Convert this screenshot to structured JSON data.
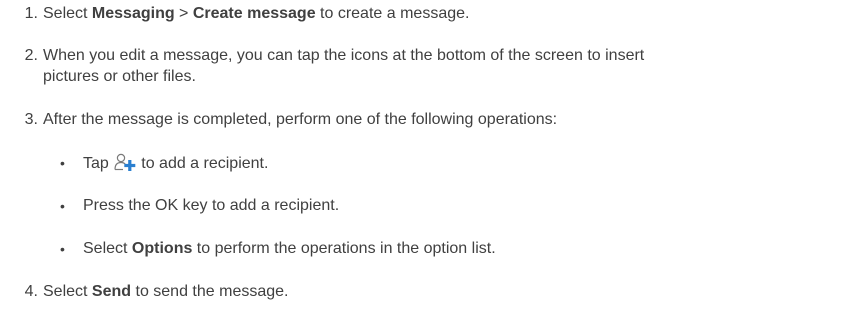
{
  "steps": [
    {
      "number": "1.",
      "pre": "Select ",
      "bold1": "Messaging",
      "mid": " > ",
      "bold2": "Create message",
      "post": " to create a message."
    },
    {
      "number": "2.",
      "line1": "When you edit a message, you can tap the icons at the bottom of the screen to insert",
      "line2": "pictures or other files."
    },
    {
      "number": "3.",
      "text": "After the message is completed, perform one of the following operations:"
    },
    {
      "number": "4.",
      "pre": "Select ",
      "bold": "Send",
      "post": " to send the message."
    }
  ],
  "bullets": [
    {
      "symbol": "•",
      "pre": "Tap ",
      "icon": "add-recipient-icon",
      "post": "to add a recipient."
    },
    {
      "symbol": "•",
      "text": "Press the OK key to add a recipient."
    },
    {
      "symbol": "•",
      "pre": "Select ",
      "bold": "Options",
      "post": " to perform the operations in the option list."
    }
  ],
  "colors": {
    "text": "#404040",
    "icon_outline": "#7a7a7a",
    "icon_plus": "#2a7fd0"
  }
}
